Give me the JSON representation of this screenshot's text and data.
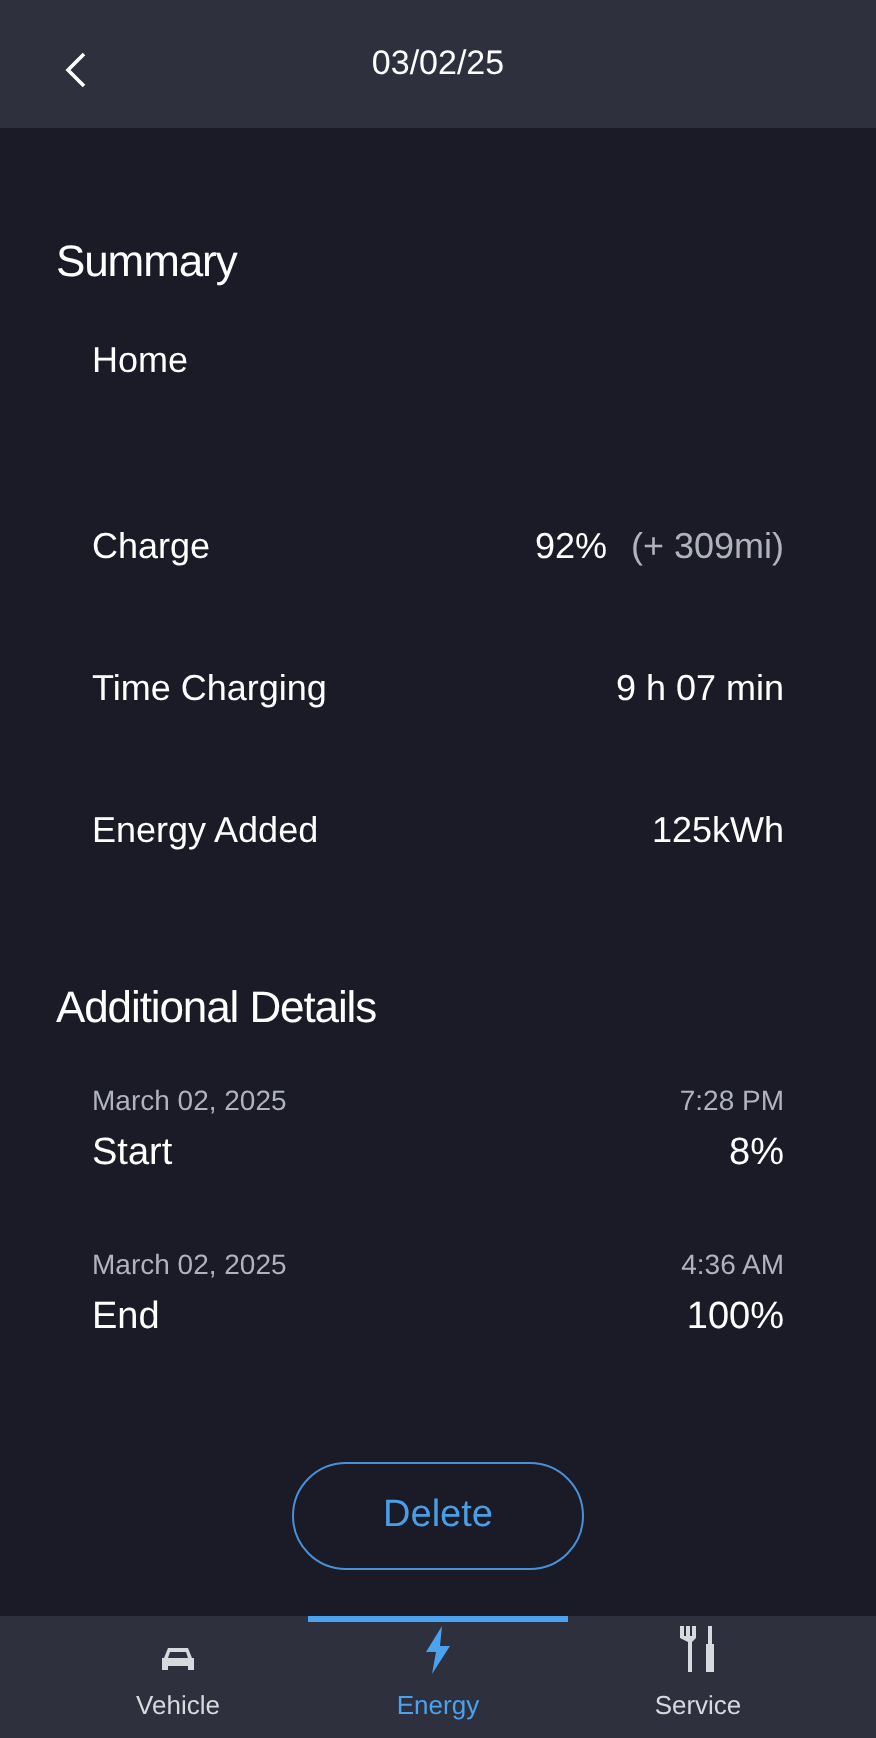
{
  "header": {
    "title": "03/02/25"
  },
  "summary": {
    "title": "Summary",
    "location": "Home",
    "rows": [
      {
        "label": "Charge",
        "value": "92%",
        "extra": "(+ 309mi)"
      },
      {
        "label": "Time Charging",
        "value": "9 h 07 min"
      },
      {
        "label": "Energy Added",
        "value": "125kWh"
      }
    ]
  },
  "details": {
    "title": "Additional Details",
    "entries": [
      {
        "date": "March 02, 2025",
        "time": "7:28 PM",
        "label": "Start",
        "value": "8%"
      },
      {
        "date": "March 02, 2025",
        "time": "4:36 AM",
        "label": "End",
        "value": "100%"
      }
    ]
  },
  "delete_button": "Delete",
  "nav": [
    {
      "kind": "car",
      "label": "Vehicle",
      "selected": false
    },
    {
      "kind": "bolt",
      "label": "Energy",
      "selected": true
    },
    {
      "kind": "tools",
      "label": "Service",
      "selected": false
    }
  ]
}
